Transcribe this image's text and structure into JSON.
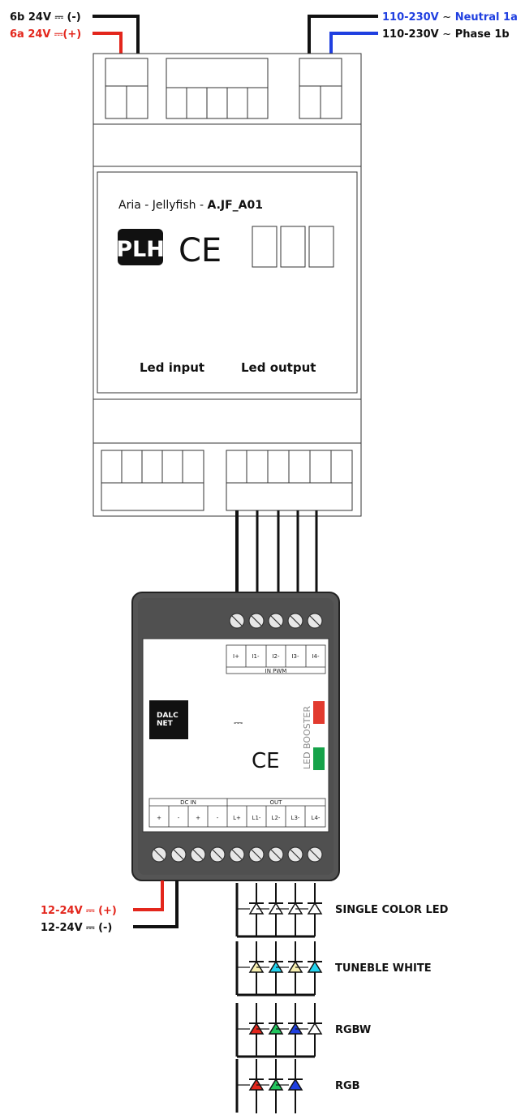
{
  "colors": {
    "red": "#e3261c",
    "blue": "#1f3fe0",
    "black": "#111111",
    "device_stroke": "#333333",
    "dalc_body": "#555555",
    "booster_red": "#e23a2e",
    "booster_green": "#16a34a"
  },
  "top_labels": {
    "left_neg": {
      "prefix": "6b 24V ",
      "symbol": "⎓",
      "suffix": " (-)"
    },
    "left_pos": {
      "prefix": "6a 24V ",
      "symbol": "⎓",
      "suffix": "(+)"
    },
    "right_neutral": {
      "prefix": "110-230V ",
      "symbol": "~",
      "suffix": " Neutral 1a"
    },
    "right_phase": {
      "prefix": "110-230V ",
      "symbol": "~",
      "suffix": " Phase 1b"
    }
  },
  "aria": {
    "title_prefix": "Aria - Jellyfish - ",
    "title_model": "A.JF_A01",
    "plh_logo": "PLH",
    "ce_mark": "CE",
    "led_input": "Led input",
    "led_output": "Led output"
  },
  "dalc": {
    "logo_line1": "DALC",
    "logo_line2": "NET",
    "dc_symbol": "⎓",
    "ce_mark": "CE",
    "booster_text": "LED BOOSTER",
    "in_pwm_title": "IN PWM",
    "in_pwm_pins": [
      "I+",
      "I1-",
      "I2-",
      "I3-",
      "I4-"
    ],
    "dc_in_title": "DC IN",
    "dc_in_pins": [
      "+",
      "-",
      "+",
      "-"
    ],
    "out_title": "OUT",
    "out_pins": [
      "L+",
      "L1-",
      "L2-",
      "L3-",
      "L4-"
    ]
  },
  "bottom_labels": {
    "pos": {
      "prefix": "12-24V ",
      "symbol": "⎓",
      "suffix": " (+)"
    },
    "neg": {
      "prefix": "12-24V ",
      "symbol": "⎓",
      "suffix": "  (-)"
    }
  },
  "led_groups": [
    {
      "label": "SINGLE COLOR LED",
      "diodes": [
        "#ffffff",
        "#ffffff",
        "#ffffff",
        "#ffffff"
      ]
    },
    {
      "label": "TUNEBLE WHITE",
      "diodes": [
        "#f7efb0",
        "#22d3ee",
        "#f7efb0",
        "#22d3ee"
      ]
    },
    {
      "label": "RGBW",
      "diodes": [
        "#e3261c",
        "#22c55e",
        "#1f3fe0",
        "#ffffff"
      ]
    },
    {
      "label": "RGB",
      "diodes": [
        "#e3261c",
        "#22c55e",
        "#1f3fe0"
      ]
    }
  ]
}
